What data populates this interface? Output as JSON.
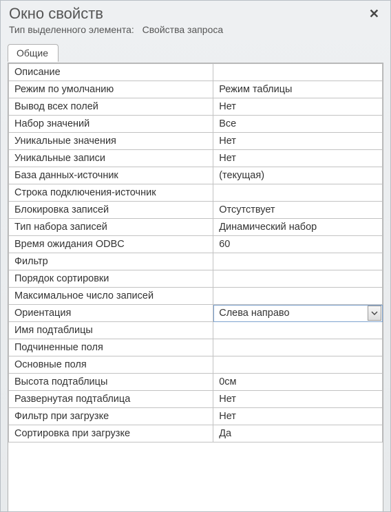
{
  "window": {
    "title": "Окно свойств",
    "subtitle_label": "Тип выделенного элемента:",
    "subtitle_value": "Свойства запроса"
  },
  "tabs": [
    {
      "label": "Общие",
      "active": true
    }
  ],
  "selected_row_index": 14,
  "properties": [
    {
      "name": "Описание",
      "value": ""
    },
    {
      "name": "Режим по умолчанию",
      "value": "Режим таблицы"
    },
    {
      "name": "Вывод всех полей",
      "value": "Нет"
    },
    {
      "name": "Набор значений",
      "value": "Все"
    },
    {
      "name": "Уникальные значения",
      "value": "Нет"
    },
    {
      "name": "Уникальные записи",
      "value": "Нет"
    },
    {
      "name": "База данных-источник",
      "value": "(текущая)"
    },
    {
      "name": "Строка подключения-источник",
      "value": ""
    },
    {
      "name": "Блокировка записей",
      "value": "Отсутствует"
    },
    {
      "name": "Тип набора записей",
      "value": "Динамический набор"
    },
    {
      "name": "Время ожидания ODBC",
      "value": "60"
    },
    {
      "name": "Фильтр",
      "value": ""
    },
    {
      "name": "Порядок сортировки",
      "value": ""
    },
    {
      "name": "Максимальное число записей",
      "value": ""
    },
    {
      "name": "Ориентация",
      "value": "Слева направо"
    },
    {
      "name": "Имя подтаблицы",
      "value": ""
    },
    {
      "name": "Подчиненные поля",
      "value": ""
    },
    {
      "name": "Основные поля",
      "value": ""
    },
    {
      "name": "Высота подтаблицы",
      "value": "0см"
    },
    {
      "name": "Развернутая подтаблица",
      "value": "Нет"
    },
    {
      "name": "Фильтр при загрузке",
      "value": "Нет"
    },
    {
      "name": "Сортировка при загрузке",
      "value": "Да"
    }
  ]
}
